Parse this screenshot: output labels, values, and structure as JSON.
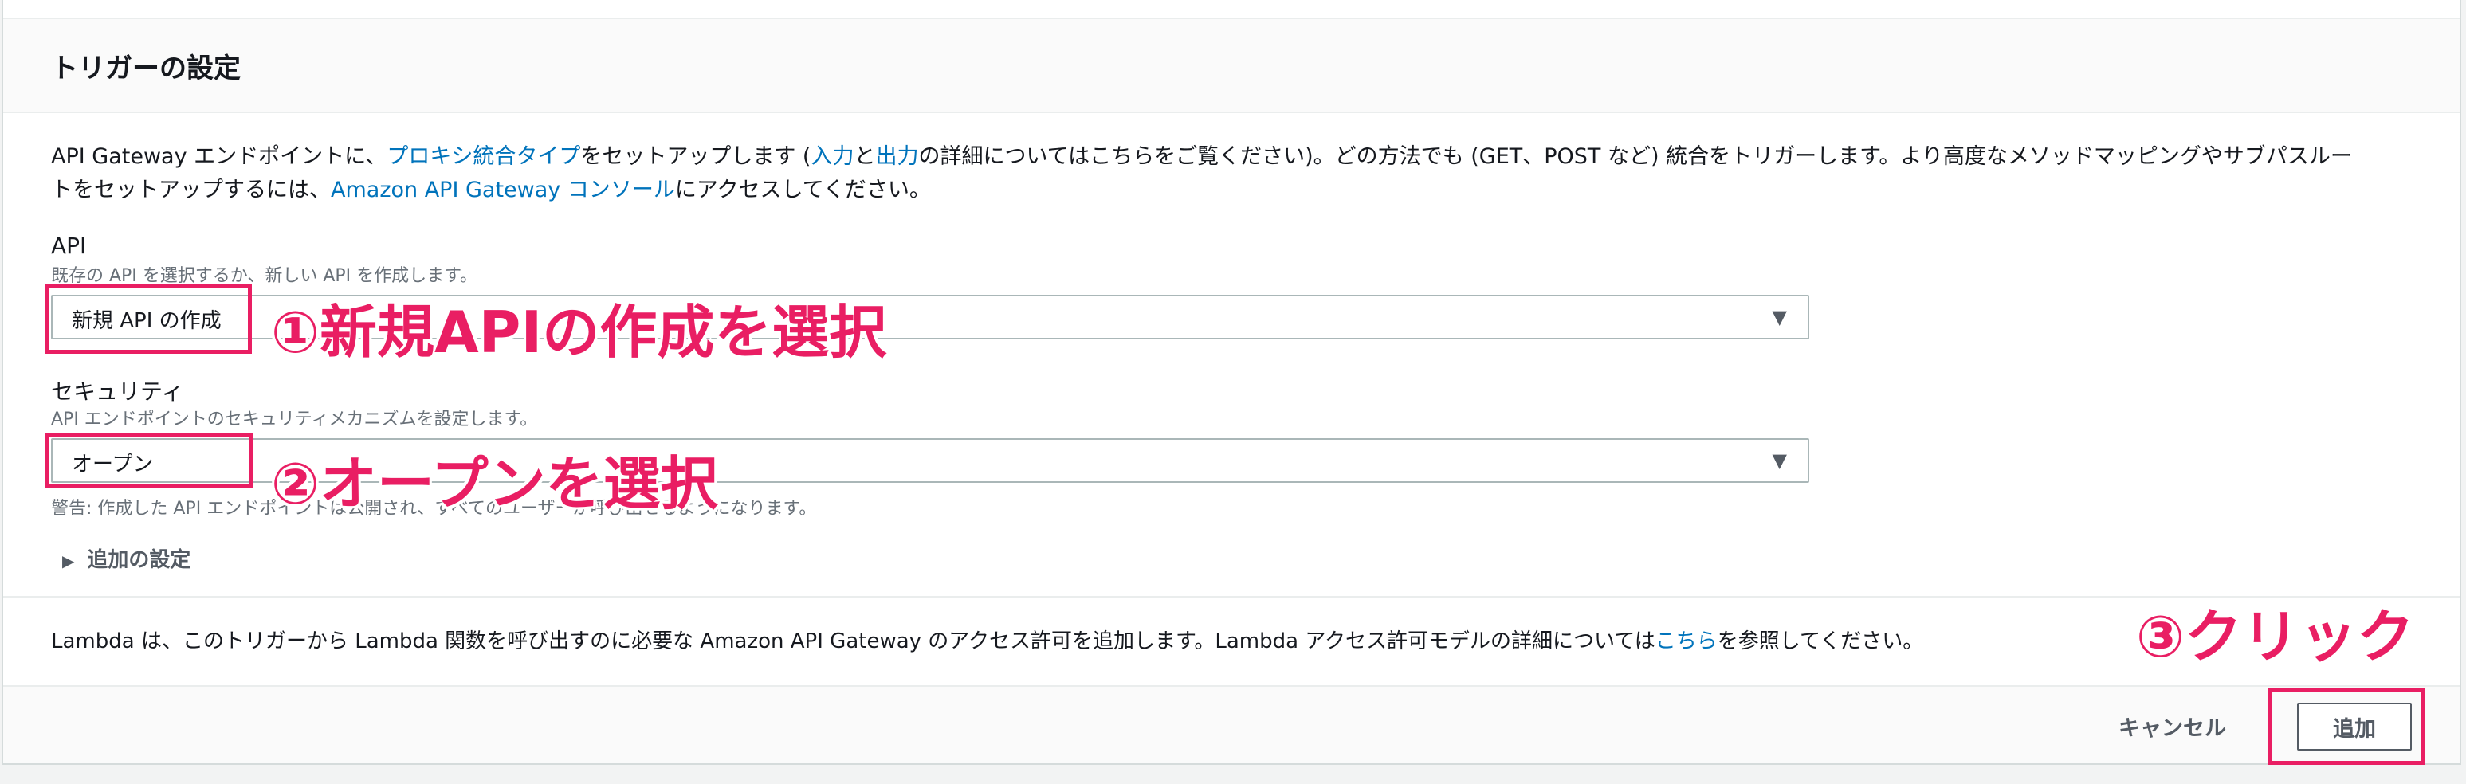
{
  "panel": {
    "title": "トリガーの設定"
  },
  "description": {
    "part1": "API Gateway エンドポイントに、",
    "link_proxy": "プロキシ統合タイプ",
    "part2": "をセットアップします (",
    "link_input": "入力",
    "part3": "と",
    "link_output": "出力",
    "part4": "の詳細についてはこちらをご覧ください)。どの方法でも (GET、POST など) 統合をトリガーします。より高度なメソッドマッピングやサブパスルー",
    "part5": "トをセットアップするには、",
    "link_console": "Amazon API Gateway コンソール",
    "part6": "にアクセスしてください。"
  },
  "api_field": {
    "label": "API",
    "description": "既存の API を選択するか、新しい API を作成します。",
    "value": "新規 API の作成"
  },
  "security_field": {
    "label": "セキュリティ",
    "description": "API エンドポイントのセキュリティメカニズムを設定します。",
    "value": "オープン",
    "warning": "警告: 作成した API エンドポイントは公開され、すべてのユーザーが呼び出せるようになります。"
  },
  "advanced": {
    "label": "追加の設定"
  },
  "lambda_note": {
    "text": "Lambda は、このトリガーから Lambda 関数を呼び出すのに必要な Amazon API Gateway のアクセス許可を追加します。Lambda アクセス許可モデルの詳細については",
    "link": "こちら",
    "suffix": "を参照してください。"
  },
  "footer": {
    "cancel_label": "キャンセル",
    "add_label": "追加"
  },
  "annotations": {
    "step1": "①新規APIの作成を選択",
    "step2": "②オープンを選択",
    "step3": "③クリック"
  },
  "icons": {
    "caret": "caret-down-icon",
    "expand": "triangle-right-icon"
  },
  "colors": {
    "link": "#0073bb",
    "highlight": "#e91e63"
  }
}
